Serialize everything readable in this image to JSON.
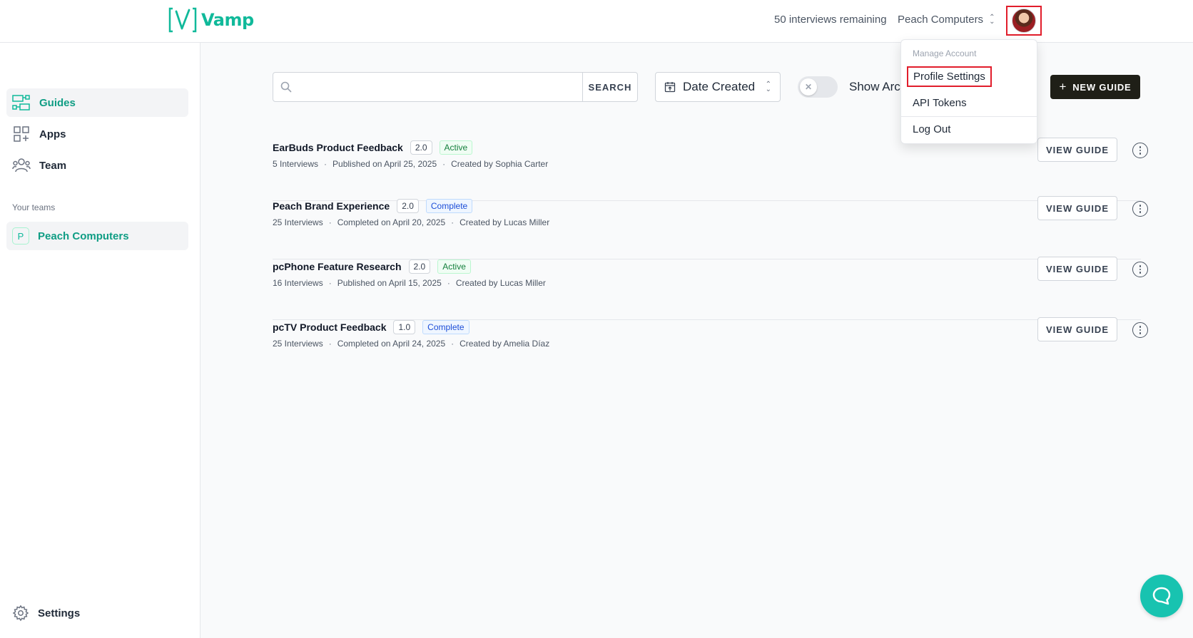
{
  "header": {
    "logo_text": "Vamp",
    "interviews_remaining": "50 interviews remaining",
    "org_name": "Peach Computers"
  },
  "sidebar": {
    "items": [
      {
        "label": "Guides",
        "icon": "guides-icon",
        "active": true
      },
      {
        "label": "Apps",
        "icon": "apps-icon",
        "active": false
      },
      {
        "label": "Team",
        "icon": "team-icon",
        "active": false
      }
    ],
    "teams_heading": "Your teams",
    "team": {
      "badge": "P",
      "label": "Peach Computers"
    },
    "settings_label": "Settings"
  },
  "toolbar": {
    "search_value": "",
    "search_placeholder": "",
    "search_button": "SEARCH",
    "sort_label": "Date Created",
    "toggle_label": "Show Arch",
    "toggle_on": false,
    "new_guide_label": "NEW GUIDE"
  },
  "guides": [
    {
      "title": "EarBuds Product Feedback",
      "version": "2.0",
      "status": "Active",
      "interviews": "5 Interviews",
      "date": "Published on April 25, 2025",
      "creator": "Created by Sophia Carter",
      "view_label": "VIEW GUIDE"
    },
    {
      "title": "Peach Brand Experience",
      "version": "2.0",
      "status": "Complete",
      "interviews": "25 Interviews",
      "date": "Completed on April 20, 2025",
      "creator": "Created by Lucas Miller",
      "view_label": "VIEW GUIDE"
    },
    {
      "title": "pcPhone Feature Research",
      "version": "2.0",
      "status": "Active",
      "interviews": "16 Interviews",
      "date": "Published on April 15, 2025",
      "creator": "Created by Lucas Miller",
      "view_label": "VIEW GUIDE"
    },
    {
      "title": "pcTV Product Feedback",
      "version": "1.0",
      "status": "Complete",
      "interviews": "25 Interviews",
      "date": "Completed on April 24, 2025",
      "creator": "Created by Amelia Díaz",
      "view_label": "VIEW GUIDE"
    }
  ],
  "account_menu": {
    "header": "Manage Account",
    "items": [
      "Profile Settings",
      "API Tokens",
      "Log Out"
    ]
  },
  "colors": {
    "brand": "#10b99a",
    "active_status": "#15803d",
    "complete_status": "#1d4ed8",
    "chat": "#18c3b0"
  }
}
